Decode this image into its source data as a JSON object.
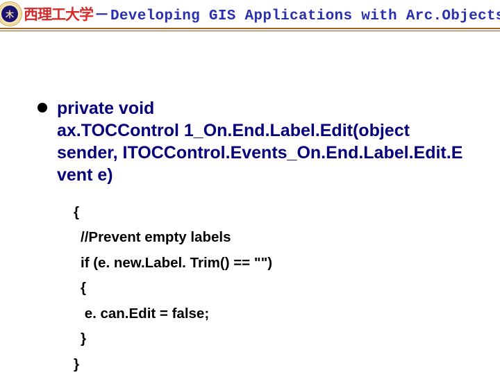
{
  "header": {
    "logo_glyph": "木",
    "university": "西理工大学",
    "separator": "－",
    "course": "Developing GIS Applications with Arc.Objects using C#. NE"
  },
  "bullet": {
    "signature_line1": " private void",
    "signature_line2": "ax.TOCControl 1_On.End.Label.Edit(object",
    "signature_line3": "sender, ITOCControl.Events_On.End.Label.Edit.E",
    "signature_line4": "vent e)"
  },
  "code": {
    "l1": "{",
    "l2": "//Prevent empty labels",
    "l3": "if (e. new.Label. Trim() == \"\")",
    "l4": "{",
    "l5": " e. can.Edit = false;",
    "l6": "}",
    "l7": "}"
  }
}
